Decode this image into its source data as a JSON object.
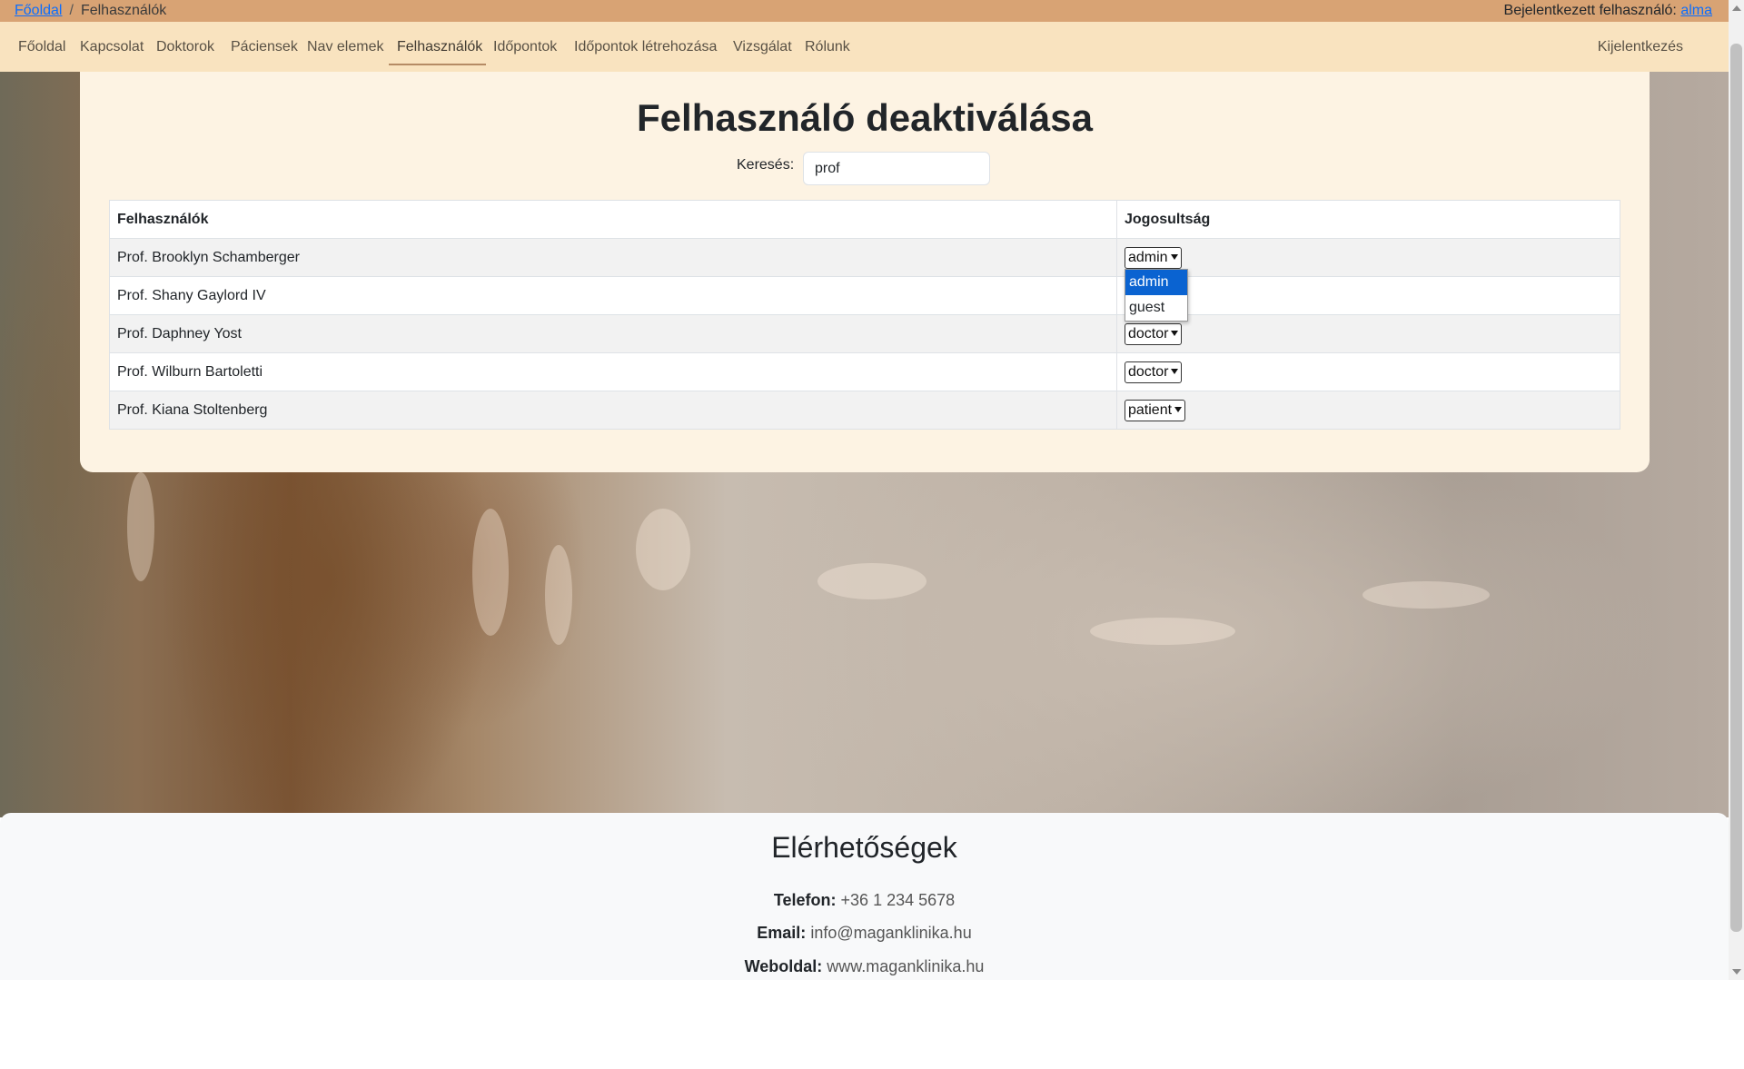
{
  "breadcrumb": {
    "home": "Főoldal",
    "separator": "/",
    "current": "Felhasználók"
  },
  "login": {
    "label": "Bejelentkezett felhasználó:",
    "user": "alma"
  },
  "nav": {
    "items": [
      "Főoldal",
      "Kapcsolat",
      "Doktorok",
      "Páciensek",
      "Nav elemek",
      "Felhasználók",
      "Időpontok",
      "Időpontok létrehozása",
      "Vizsgálat",
      "Rólunk"
    ],
    "active": "Felhasználók",
    "logout": "Kijelentkezés"
  },
  "page": {
    "title": "Felhasználó deaktiválása"
  },
  "search": {
    "label": "Keresés:",
    "value": "prof"
  },
  "table": {
    "headers": [
      "Felhasználók",
      "Jogosultság"
    ],
    "rows": [
      {
        "name": "Prof. Brooklyn Schamberger",
        "role": "admin"
      },
      {
        "name": "Prof. Shany Gaylord IV",
        "role": ""
      },
      {
        "name": "Prof. Daphney Yost",
        "role": "doctor"
      },
      {
        "name": "Prof. Wilburn Bartoletti",
        "role": "doctor"
      },
      {
        "name": "Prof. Kiana Stoltenberg",
        "role": "patient"
      }
    ]
  },
  "dropdown": {
    "options": [
      "admin",
      "guest"
    ],
    "selected": "admin"
  },
  "footer": {
    "title": "Elérhetőségek",
    "phone_label": "Telefon:",
    "phone": "+36 1 234 5678",
    "email_label": "Email:",
    "email": "info@maganklinika.hu",
    "web_label": "Weboldal:",
    "web": "www.maganklinika.hu"
  },
  "colors": {
    "breadcrumb_bar": "#d8a374",
    "navbar": "#f9e3bf",
    "card": "#fdf3e3",
    "dropdown_highlight": "#0a63d1"
  }
}
